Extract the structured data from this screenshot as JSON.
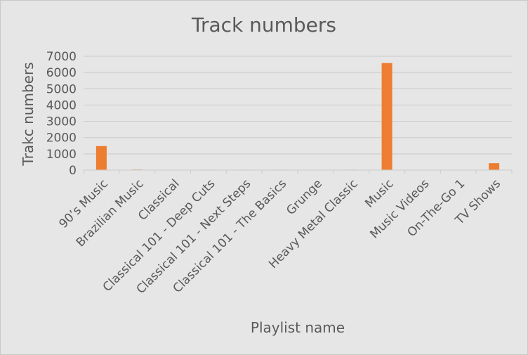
{
  "chart_data": {
    "type": "bar",
    "title": "Track numbers",
    "xlabel": "Playlist name",
    "ylabel": "Trakc numbers",
    "categories": [
      "90’s Music",
      "Brazilian Music",
      "Classical",
      "Classical 101 - Deep Cuts",
      "Classical 101 - Next Steps",
      "Classical 101 - The Basics",
      "Grunge",
      "Heavy Metal Classic",
      "Music",
      "Music Videos",
      "On-The-Go 1",
      "TV Shows"
    ],
    "values": [
      1477,
      39,
      0,
      25,
      25,
      25,
      15,
      26,
      6580,
      1,
      1,
      426
    ],
    "ylim": [
      0,
      7000
    ],
    "yticks": [
      0,
      1000,
      2000,
      3000,
      4000,
      5000,
      6000,
      7000
    ],
    "grid": true,
    "legend": "none",
    "bar_color": "#ed7d31"
  }
}
